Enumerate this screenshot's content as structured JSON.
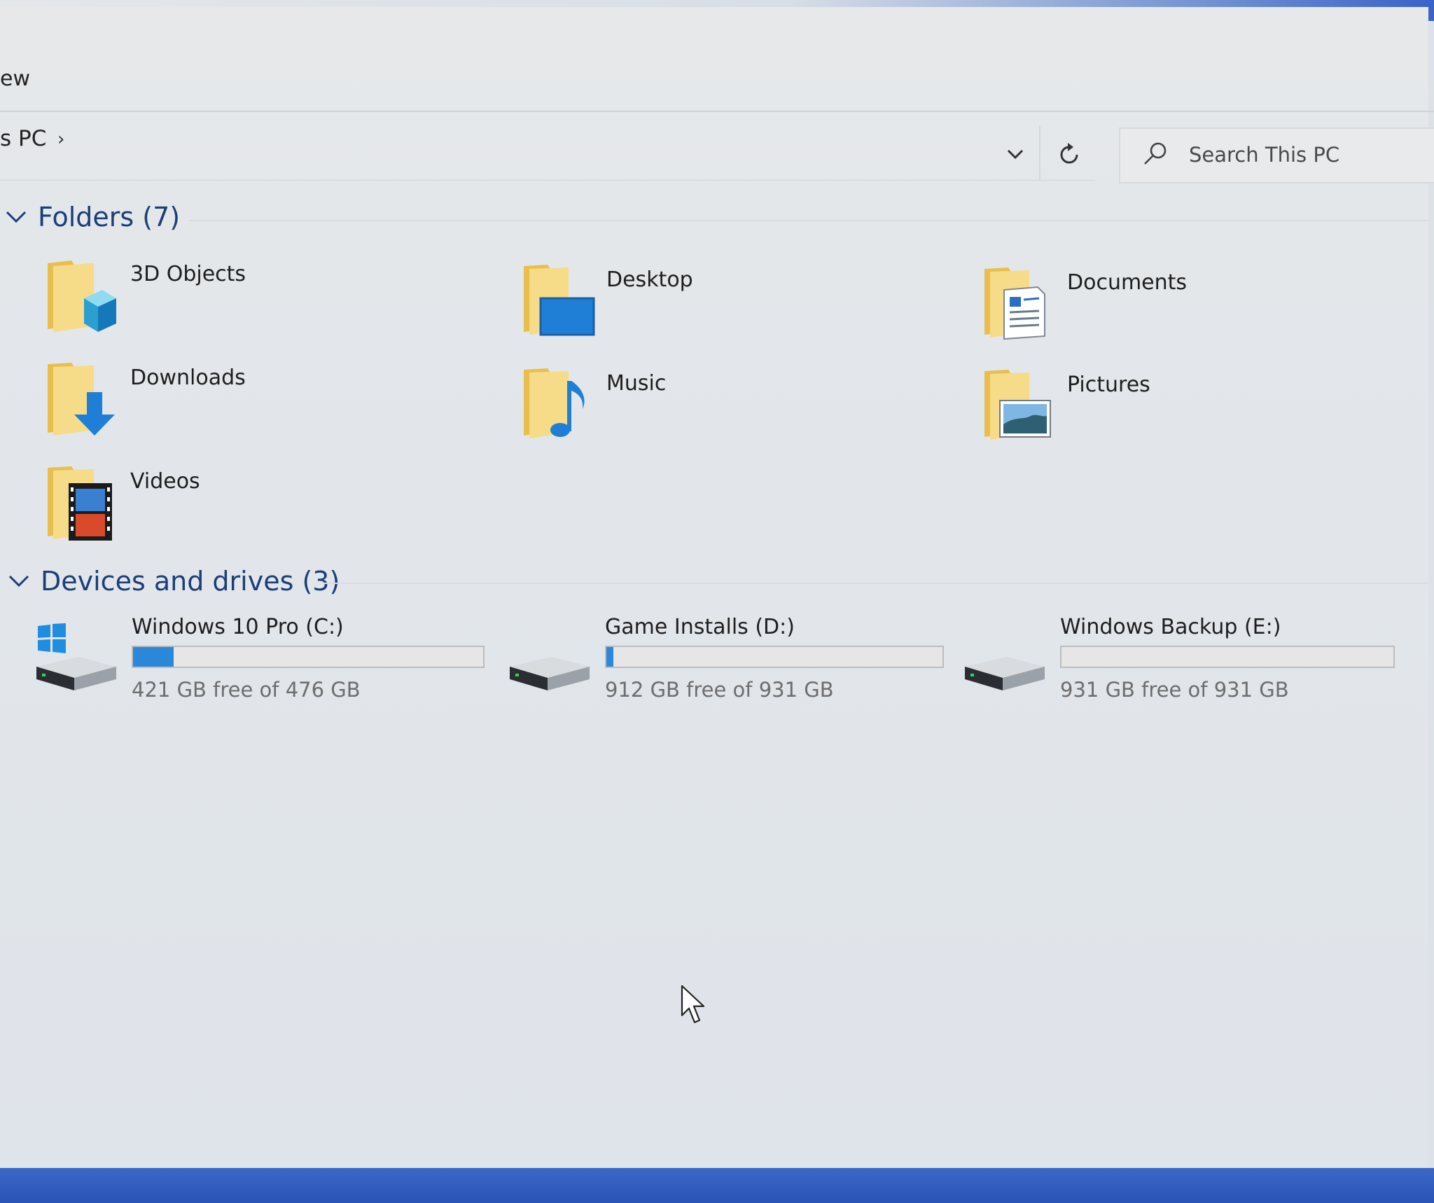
{
  "ribbon": {
    "visible_tab_fragment": "ew"
  },
  "address_bar": {
    "crumb_fragment": "s PC",
    "separator": "›"
  },
  "search": {
    "placeholder": "Search This PC"
  },
  "sections": {
    "folders": {
      "title": "Folders (7)"
    },
    "drives": {
      "title": "Devices and drives (3)"
    }
  },
  "folders": [
    {
      "label": "3D Objects",
      "icon": "3d-objects-folder-icon"
    },
    {
      "label": "Desktop",
      "icon": "desktop-folder-icon"
    },
    {
      "label": "Documents",
      "icon": "documents-folder-icon"
    },
    {
      "label": "Downloads",
      "icon": "downloads-folder-icon"
    },
    {
      "label": "Music",
      "icon": "music-folder-icon"
    },
    {
      "label": "Pictures",
      "icon": "pictures-folder-icon"
    },
    {
      "label": "Videos",
      "icon": "videos-folder-icon"
    }
  ],
  "drives": [
    {
      "name": "Windows 10 Pro (C:)",
      "free_text": "421 GB free of 476 GB",
      "used_fraction": 0.116,
      "icon": "windows-system-drive-icon"
    },
    {
      "name": "Game Installs (D:)",
      "free_text": "912 GB free of 931 GB",
      "used_fraction": 0.02,
      "icon": "hard-drive-icon"
    },
    {
      "name": "Windows Backup (E:)",
      "free_text": "931 GB free of 931 GB",
      "used_fraction": 0.0,
      "icon": "hard-drive-icon"
    }
  ],
  "colors": {
    "accent": "#2b88d8",
    "section_header": "#1a3f78",
    "folder_yellow": "#f2d37a",
    "taskbar_blue": "#2a54b6"
  }
}
